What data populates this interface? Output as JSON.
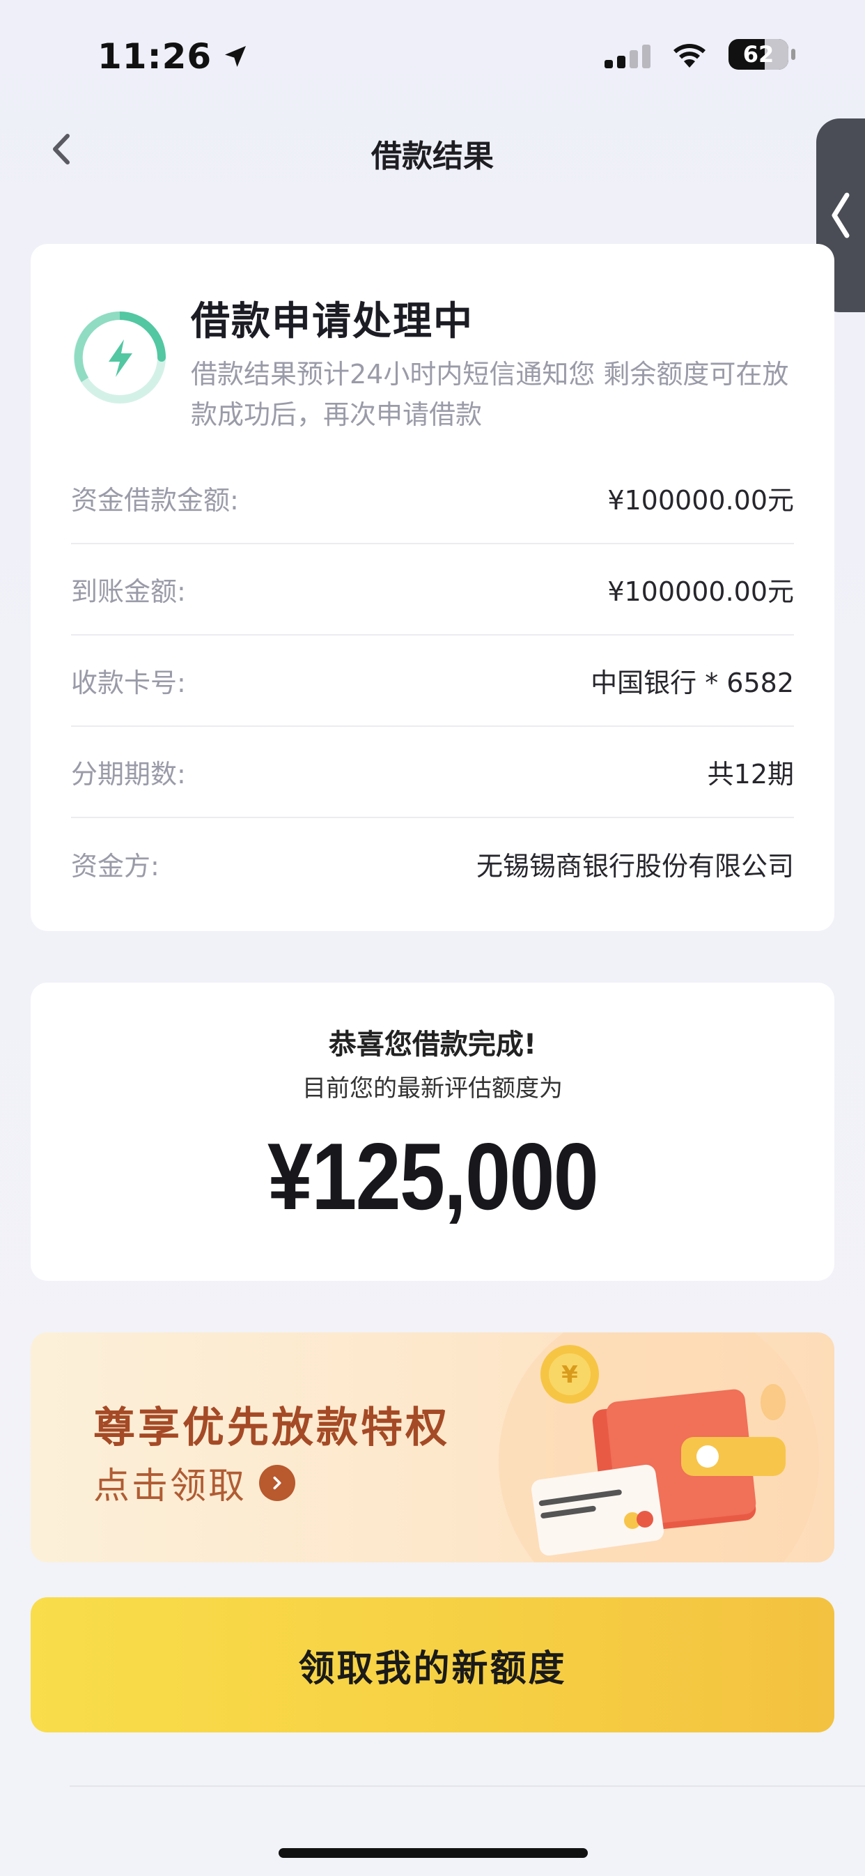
{
  "status_bar": {
    "time": "11:26",
    "battery": "62"
  },
  "nav": {
    "title": "借款结果"
  },
  "status_card": {
    "title": "借款申请处理中",
    "description": "借款结果预计24小时内短信通知您 剩余额度可在放款成功后，再次申请借款",
    "rows": [
      {
        "label": "资金借款金额:",
        "value": "¥100000.00元"
      },
      {
        "label": "到账金额:",
        "value": "¥100000.00元"
      },
      {
        "label": "收款卡号:",
        "value": "中国银行 * 6582"
      },
      {
        "label": "分期期数:",
        "value": "共12期"
      },
      {
        "label": "资金方:",
        "value": "无锡锡商银行股份有限公司"
      }
    ]
  },
  "credit_card": {
    "congrats": "恭喜您借款完成!",
    "subtitle": "目前您的最新评估额度为",
    "amount": "¥125,000"
  },
  "banner": {
    "title": "尊享优先放款特权",
    "link": "点击领取"
  },
  "primary_button": {
    "label": "领取我的新额度"
  },
  "colors": {
    "accent_yellow": "#f6cf43",
    "banner_title": "#a54a26",
    "status_green": "#52c7a2"
  }
}
